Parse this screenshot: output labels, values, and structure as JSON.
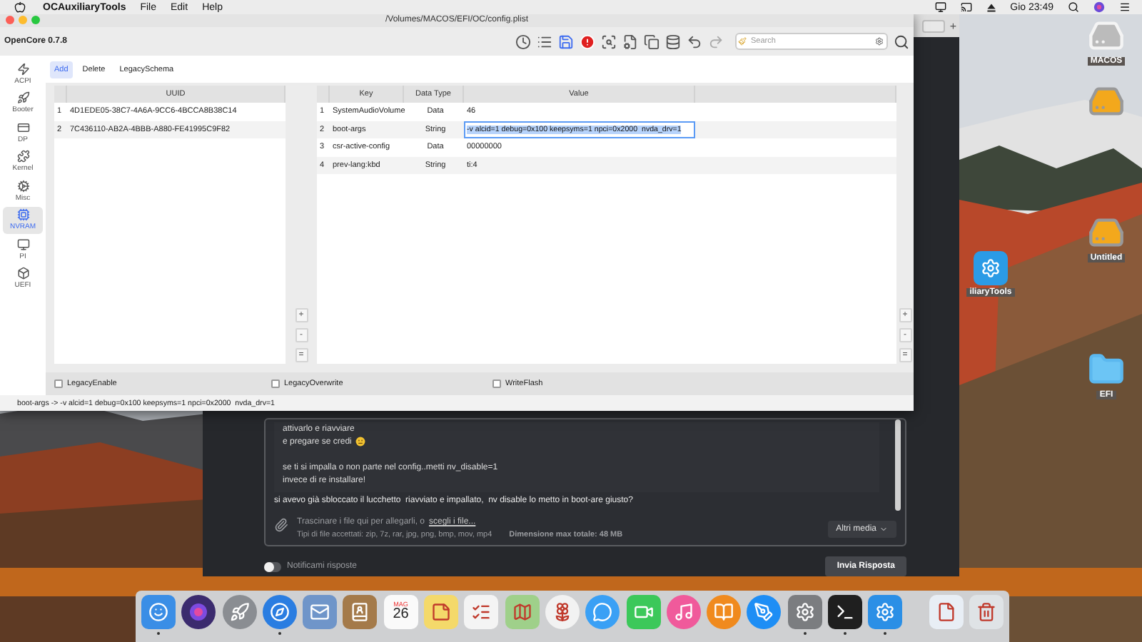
{
  "menu_bar": {
    "app": "OCAuxiliaryTools",
    "menus": [
      "File",
      "Edit",
      "Help"
    ],
    "clock": "Gio 23:49"
  },
  "desktop_icons": [
    {
      "kind": "disk",
      "label": "MACOS"
    },
    {
      "kind": "drive"
    },
    {
      "kind": "drive",
      "label": "Untitled"
    },
    {
      "kind": "app",
      "label": "iliaryTools"
    },
    {
      "kind": "folder",
      "label": "EFI"
    }
  ],
  "browser": {
    "new_tab": "+",
    "quote_lines": [
      "attivarlo e riavviare",
      "e pregare se credi",
      "se ti si impalla o non parte nel config..metti nv_disable=1",
      "invece di re installare!"
    ],
    "reply": "si avevo già sbloccato il lucchetto  riavviato e impallato,  nv disable lo metto in boot-are giusto?",
    "attach_text": "Trascinare i file qui per allegarli, o",
    "attach_link": "scegli i file...",
    "file_types": "Tipi di file accettati: zip, 7z, rar, jpg, png, bmp, mov, mp4",
    "max_size": "Dimensione max totale: 48 MB",
    "media_button": "Altri media",
    "notify": {
      "label": "Notificami risposte",
      "on": false
    },
    "submit": "Invia Risposta"
  },
  "window": {
    "title": "/Volumes/MACOS/EFI/OC/config.plist",
    "app_name": "OpenCore 0.7.8",
    "search": {
      "placeholder": "Search"
    },
    "sidebar": [
      {
        "label": "ACPI",
        "selected": false
      },
      {
        "label": "Booter",
        "selected": false
      },
      {
        "label": "DP",
        "selected": false
      },
      {
        "label": "Kernel",
        "selected": false
      },
      {
        "label": "Misc",
        "selected": false
      },
      {
        "label": "NVRAM",
        "selected": true
      },
      {
        "label": "PI",
        "selected": false
      },
      {
        "label": "UEFI",
        "selected": false
      }
    ],
    "tabs": [
      {
        "label": "Add",
        "selected": true
      },
      {
        "label": "Delete",
        "selected": false
      },
      {
        "label": "LegacySchema",
        "selected": false
      }
    ],
    "uuid_table": {
      "columns": [
        "UUID"
      ],
      "rows": [
        {
          "number": "1",
          "uuid": "4D1EDE05-38C7-4A6A-9CC6-4BCCA8B38C14"
        },
        {
          "number": "2",
          "uuid": "7C436110-AB2A-4BBB-A880-FE41995C9F82"
        }
      ]
    },
    "key_table": {
      "columns": [
        "Key",
        "Data Type",
        "Value"
      ],
      "rows": [
        {
          "number": "1",
          "key": "SystemAudioVolume",
          "type": "Data",
          "value": "46",
          "editing": false
        },
        {
          "number": "2",
          "key": "boot-args",
          "type": "String",
          "value": "-v alcid=1 debug=0x100 keepsyms=1 npci=0x2000  nvda_drv=1",
          "editing": true
        },
        {
          "number": "3",
          "key": "csr-active-config",
          "type": "Data",
          "value": "00000000",
          "editing": false
        },
        {
          "number": "4",
          "key": "prev-lang:kbd",
          "type": "String",
          "value": "ti:4",
          "editing": false
        }
      ]
    },
    "row_buttons": [
      "+",
      "-",
      "="
    ],
    "options": [
      {
        "label": "LegacyEnable",
        "checked": false
      },
      {
        "label": "LegacyOverwrite",
        "checked": false
      },
      {
        "label": "WriteFlash",
        "checked": false
      }
    ],
    "status_bar": "boot-args -> -v alcid=1 debug=0x100 keepsyms=1 npci=0x2000  nvda_drv=1"
  },
  "dock": [
    {
      "kind": "finder",
      "running": true
    },
    {
      "kind": "siri",
      "running": false
    },
    {
      "kind": "launchpad",
      "running": false
    },
    {
      "kind": "safari",
      "running": true
    },
    {
      "kind": "mail",
      "running": false
    },
    {
      "kind": "contacts",
      "running": false
    },
    {
      "kind": "calendar",
      "running": false,
      "month": "MAG",
      "day": "26"
    },
    {
      "kind": "notes",
      "running": false
    },
    {
      "kind": "reminders",
      "running": false
    },
    {
      "kind": "maps",
      "running": false
    },
    {
      "kind": "photos",
      "running": false
    },
    {
      "kind": "messages",
      "running": false
    },
    {
      "kind": "facetime",
      "running": false
    },
    {
      "kind": "music",
      "running": false
    },
    {
      "kind": "books",
      "running": false
    },
    {
      "kind": "appstore",
      "running": false
    },
    {
      "kind": "preferences",
      "running": true
    },
    {
      "kind": "terminal",
      "running": true
    },
    {
      "kind": "ocat",
      "running": true
    },
    {
      "kind": "separator"
    },
    {
      "kind": "document",
      "running": false
    },
    {
      "kind": "trash",
      "running": false
    }
  ]
}
